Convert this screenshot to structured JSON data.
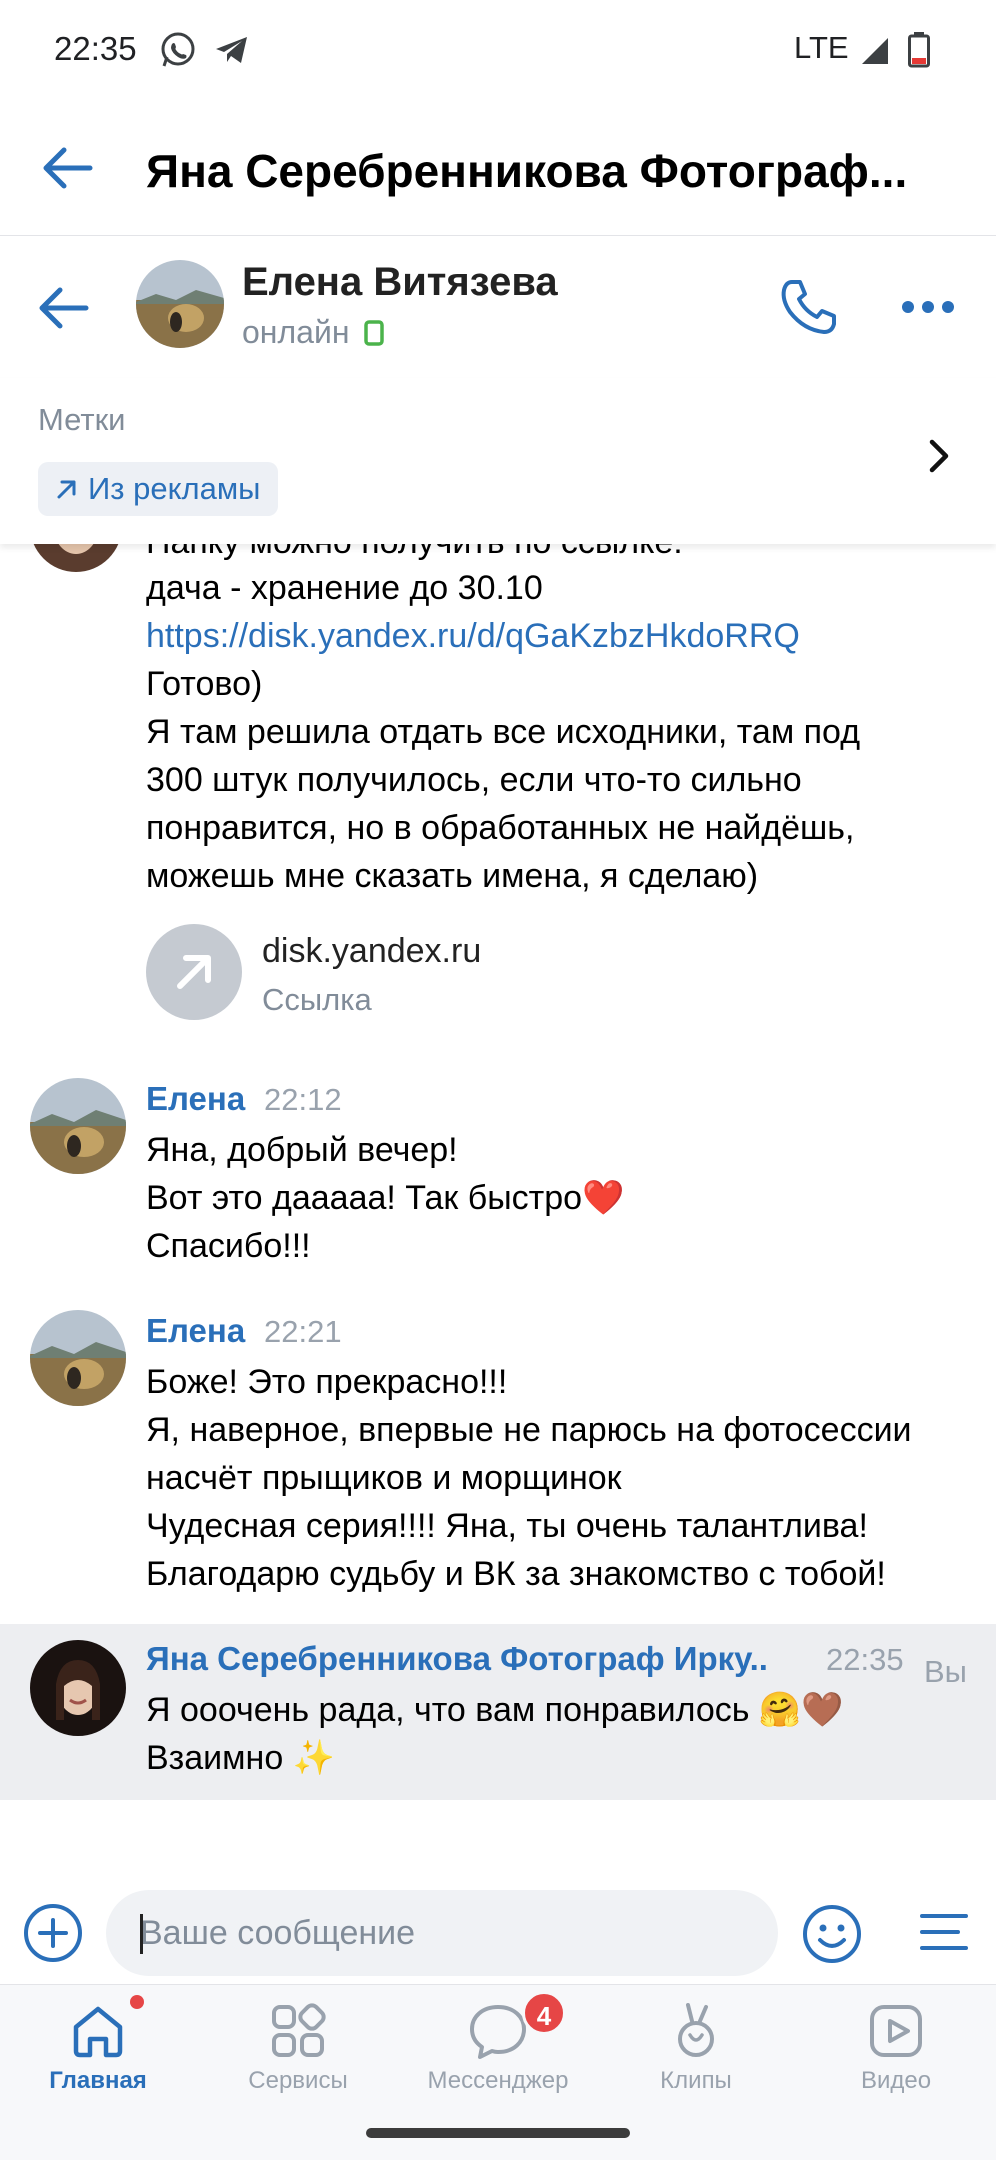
{
  "status_bar": {
    "time": "22:35",
    "network": "LTE",
    "icons": [
      "whatsapp-icon",
      "telegram-icon",
      "signal-icon",
      "battery-low-icon"
    ]
  },
  "community_header": {
    "title": "Яна Серебренникова Фотограф..."
  },
  "chat_header": {
    "name": "Елена Витязева",
    "status": "онлайн",
    "status_color": "#4bb34b"
  },
  "tags": {
    "label": "Метки",
    "chip": "Из рекламы"
  },
  "messages": {
    "first_partial": {
      "top_cut": "Папку можно получить по ссылке:",
      "line1": "дача - хранение до 30.10",
      "link": "https://disk.yandex.ru/d/qGaKzbzHkdoRRQ",
      "line2": "Готово)",
      "line3": "Я там решила отдать все исходники, там под\n300 штук получилось, если что-то сильно\nпонравится, но в обработанных не найдёшь,\nможешь мне сказать имена, я сделаю)",
      "link_card": {
        "domain": "disk.yandex.ru",
        "type": "Ссылка"
      }
    },
    "msg2": {
      "sender": "Елена",
      "time": "22:12",
      "text": "Яна, добрый вечер!\nВот это даааaa! Так быстро❤️\nСпасибо!!!"
    },
    "msg3": {
      "sender": "Елена",
      "time": "22:21",
      "text": "Боже! Это прекрасно!!!\nЯ, наверное, впервые не парюсь на фотосессии\nнасчёт прыщиков и морщинок\nЧудесная серия!!!! Яна, ты очень талантлива!\nБлагодарю судьбу и ВК за знакомство с тобой!"
    },
    "msg4": {
      "sender": "Яна Серебренникова Фотограф Ирку...",
      "time": "22:35",
      "you": "Вы",
      "text": "Я ооочень рада, что вам понравилось 🤗🤎\nВзаимно ✨"
    }
  },
  "composer": {
    "placeholder": "Ваше сообщение"
  },
  "bottom_nav": {
    "items": [
      {
        "label": "Главная",
        "icon": "home-icon",
        "active": true
      },
      {
        "label": "Сервисы",
        "icon": "services-icon"
      },
      {
        "label": "Мессенджер",
        "icon": "messenger-icon",
        "badge": "4"
      },
      {
        "label": "Клипы",
        "icon": "clips-icon"
      },
      {
        "label": "Видео",
        "icon": "video-icon"
      }
    ]
  },
  "colors": {
    "accent": "#2a6fb9",
    "badge": "#e64646",
    "reply_bg": "#edeef1"
  }
}
